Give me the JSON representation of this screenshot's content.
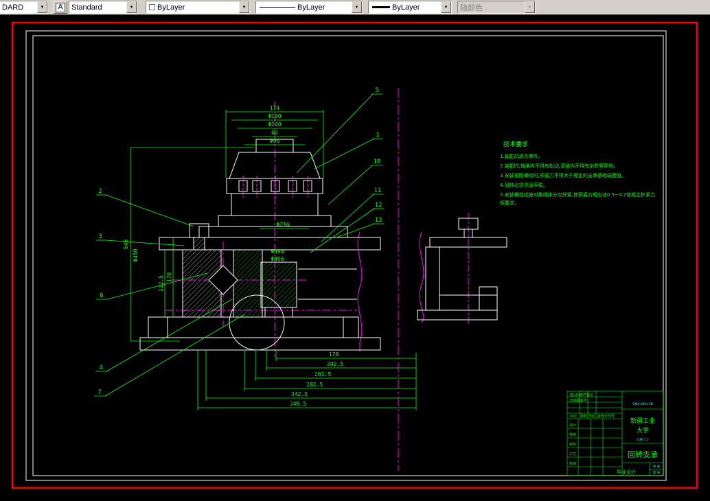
{
  "toolbar": {
    "text_style_value": "DARD",
    "style_icon_glyph": "A",
    "dim_style_value": "Standard",
    "color_value": "ByLayer",
    "linetype_value": "ByLayer",
    "lineweight_value": "ByLayer",
    "plot_style_value": "随颜色",
    "arrow_glyph": "▼"
  },
  "tech_req": {
    "title": "技术要求",
    "lines": [
      "1.装配前清洗零件。",
      "2.装配时,轴承内不得有松动,滚道内不得有杂质等异物。",
      "3.安装紧固螺栓时,预紧力不得大于规定的支承基础端面值。",
      "4.回转必须灵活平稳。",
      "5.安装螺栓应按对角顺序分次拧紧,其预紧力矩应达0.5~0.7倍规定拧紧力",
      "矩要求。"
    ]
  },
  "dims": {
    "top": [
      "174",
      "Φ160",
      "Φ140",
      "66",
      "Φ98"
    ],
    "mid": [
      "Φ216",
      "Φ498",
      "Φ456"
    ],
    "left": [
      "546",
      "Φ450",
      "170",
      "122.5"
    ],
    "bottom": [
      "178",
      "202.5",
      "261.5",
      "282.5",
      "342.5",
      "349.5"
    ]
  },
  "callouts": {
    "right": [
      "5",
      "1",
      "10",
      "11",
      "12",
      "13"
    ],
    "left": [
      "2",
      "3",
      "6",
      "4",
      "7"
    ]
  },
  "title_block": {
    "part_name": "回转支承",
    "school_line1": "新疆工业",
    "school_line2": "大学",
    "project": "毕业设计",
    "model": "QNA.400×5B",
    "scale_text": "比例 1:2",
    "labels": {
      "reg1": "借(通)用件登记",
      "reg2": "旧底图总号",
      "mark": "标记",
      "count": "处数",
      "zone": "分区",
      "doc_no": "更改文件号",
      "design": "设计",
      "check": "校核",
      "review": "审核",
      "process": "工艺",
      "approve": "批准",
      "sheets": "共 张",
      "sheet_no": "第 张"
    }
  }
}
